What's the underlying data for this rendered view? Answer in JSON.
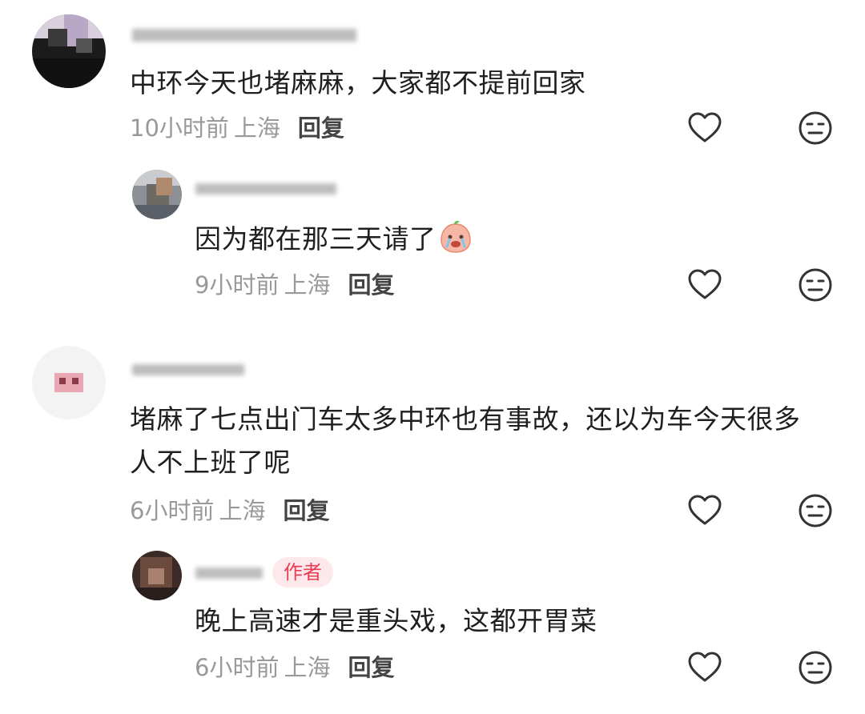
{
  "comments": [
    {
      "text": "中环今天也堵麻麻，大家都不提前回家",
      "time": "10小时前",
      "location": "上海",
      "reply_label": "回复",
      "replies": [
        {
          "text": "因为都在那三天请了",
          "time": "9小时前",
          "location": "上海",
          "reply_label": "回复"
        }
      ]
    },
    {
      "text_line1": "堵麻了七点出门车太多中环也有事故，还以为车今天很多",
      "text_line2": "人不上班了呢",
      "time": "6小时前",
      "location": "上海",
      "reply_label": "回复",
      "replies": [
        {
          "badge": "作者",
          "text": "晚上高速才是重头戏，这都开胃菜",
          "time": "6小时前",
          "location": "上海",
          "reply_label": "回复"
        }
      ]
    }
  ],
  "icons": {
    "like": "heart-outline-icon",
    "dislike": "neutral-face-icon",
    "emoji": "crying-peach-emoji-icon"
  },
  "colors": {
    "author_badge_bg": "#fde9ec",
    "author_badge_text": "#ea3c52",
    "meta_text": "#999999",
    "icon_stroke": "#333333"
  }
}
